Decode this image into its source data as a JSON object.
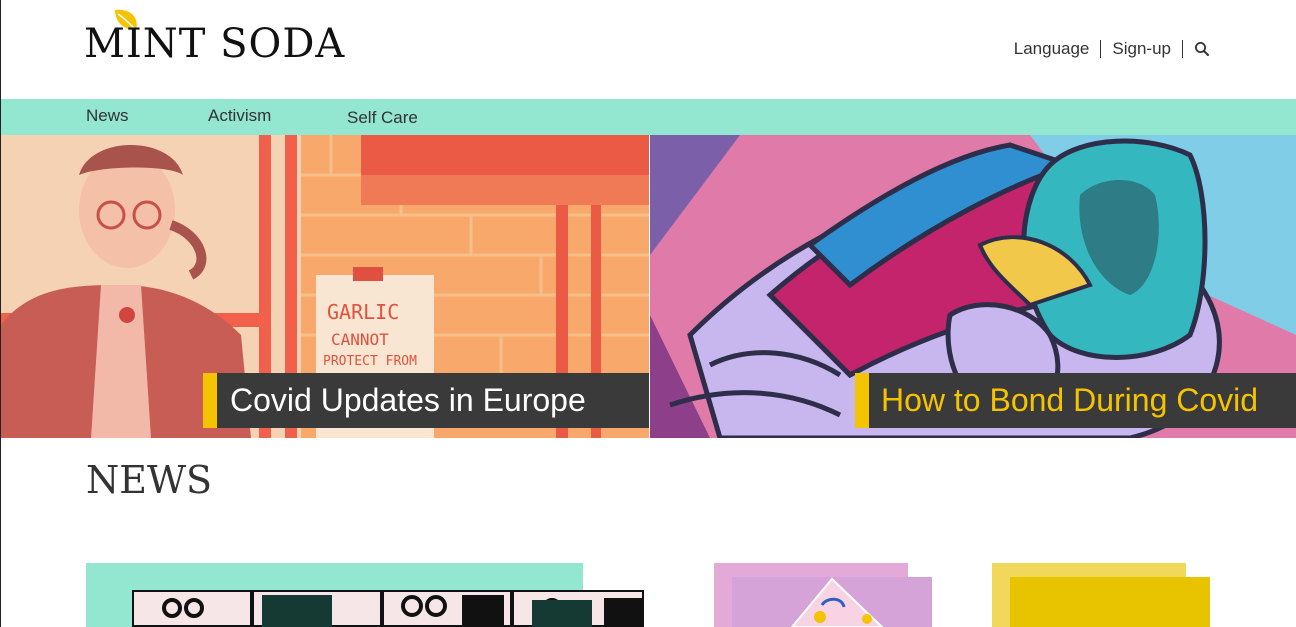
{
  "brand": {
    "name": "MINT SODA",
    "accent": "#f5c400",
    "mint": "#93e6cf"
  },
  "header": {
    "links": [
      {
        "label": "Language"
      },
      {
        "label": "Sign-up"
      }
    ],
    "search_icon": "search-icon"
  },
  "nav": {
    "items": [
      {
        "label": "News"
      },
      {
        "label": "Activism"
      },
      {
        "label": "Self Care"
      }
    ]
  },
  "hero": {
    "left": {
      "title": "Covid Updates in Europe",
      "poster_lines": [
        "GARLIC",
        "CANNOT",
        "PROTECT FROM"
      ]
    },
    "right": {
      "title": "How to Bond During Covid"
    }
  },
  "news": {
    "heading": "NEWS"
  }
}
